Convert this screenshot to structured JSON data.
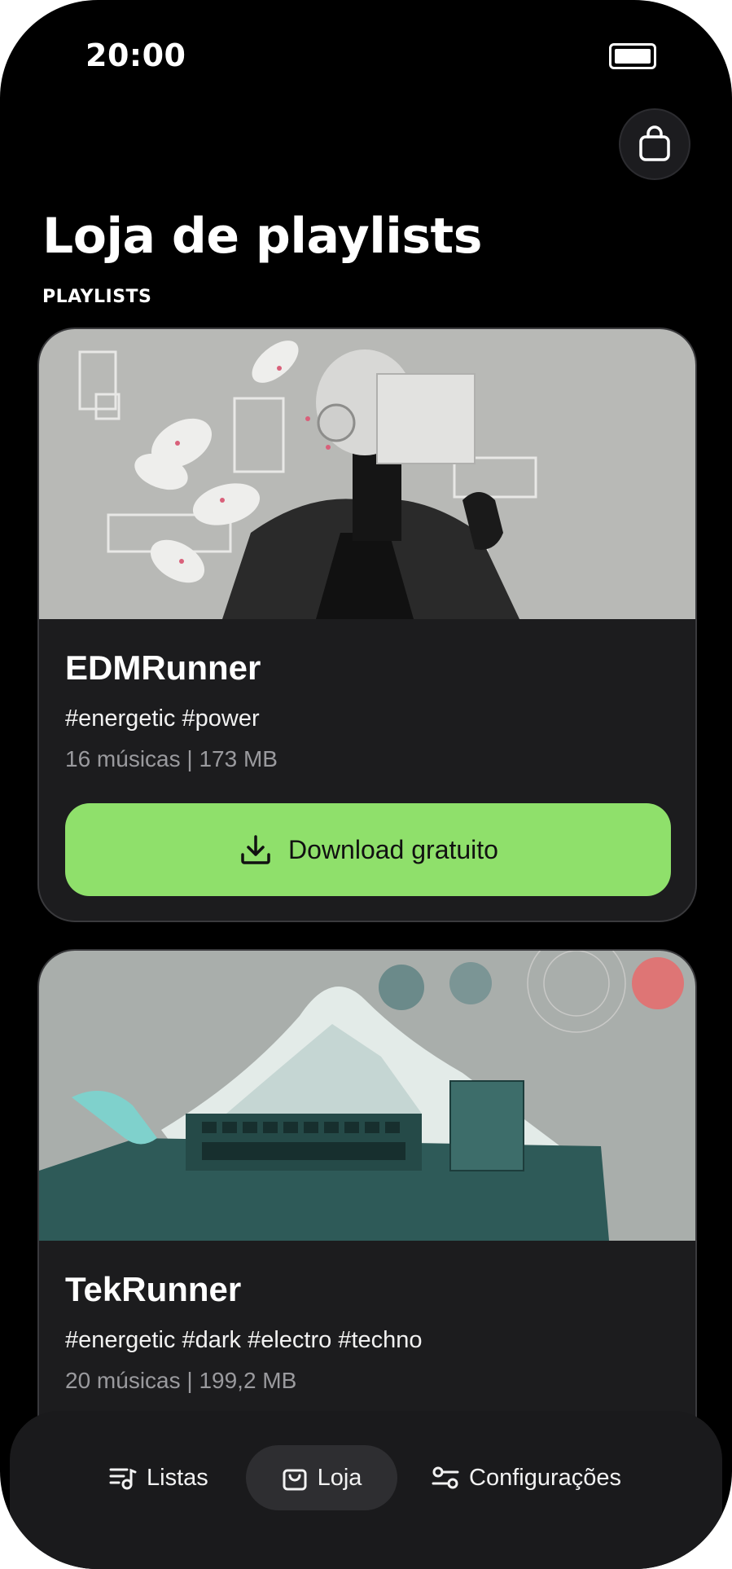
{
  "status_bar": {
    "time": "20:00"
  },
  "header": {
    "title": "Loja de playlists",
    "section_label": "PLAYLISTS"
  },
  "playlists": [
    {
      "name": "EDMRunner",
      "tags": "#energetic #power",
      "meta": "16 músicas | 173 MB",
      "button_label": "Download gratuito"
    },
    {
      "name": "TekRunner",
      "tags": "#energetic #dark #electro #techno",
      "meta": "20 músicas | 199,2 MB"
    }
  ],
  "bottom_nav": {
    "items": [
      {
        "label": "Listas",
        "icon": "playlist-icon"
      },
      {
        "label": "Loja",
        "icon": "shopping-bag-icon",
        "active": true
      },
      {
        "label": "Configurações",
        "icon": "sliders-icon"
      }
    ]
  },
  "colors": {
    "accent": "#8fe06b",
    "background": "#000000",
    "card": "#1c1c1e"
  }
}
